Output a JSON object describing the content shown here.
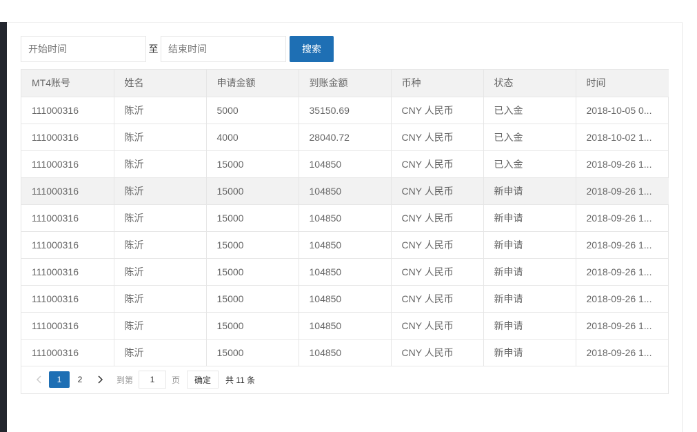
{
  "filter": {
    "start_placeholder": "开始时间",
    "separator": "至",
    "end_placeholder": "结束时间",
    "search_label": "搜索"
  },
  "table": {
    "headers": [
      "MT4账号",
      "姓名",
      "申请金额",
      "到账金额",
      "币种",
      "状态",
      "时间"
    ],
    "rows": [
      [
        "111000316",
        "陈沂",
        "5000",
        "35150.69",
        "CNY 人民币",
        "已入金",
        "2018-10-05 0..."
      ],
      [
        "111000316",
        "陈沂",
        "4000",
        "28040.72",
        "CNY 人民币",
        "已入金",
        "2018-10-02 1..."
      ],
      [
        "111000316",
        "陈沂",
        "15000",
        "104850",
        "CNY 人民币",
        "已入金",
        "2018-09-26 1..."
      ],
      [
        "111000316",
        "陈沂",
        "15000",
        "104850",
        "CNY 人民币",
        "新申请",
        "2018-09-26 1..."
      ],
      [
        "111000316",
        "陈沂",
        "15000",
        "104850",
        "CNY 人民币",
        "新申请",
        "2018-09-26 1..."
      ],
      [
        "111000316",
        "陈沂",
        "15000",
        "104850",
        "CNY 人民币",
        "新申请",
        "2018-09-26 1..."
      ],
      [
        "111000316",
        "陈沂",
        "15000",
        "104850",
        "CNY 人民币",
        "新申请",
        "2018-09-26 1..."
      ],
      [
        "111000316",
        "陈沂",
        "15000",
        "104850",
        "CNY 人民币",
        "新申请",
        "2018-09-26 1..."
      ],
      [
        "111000316",
        "陈沂",
        "15000",
        "104850",
        "CNY 人民币",
        "新申请",
        "2018-09-26 1..."
      ],
      [
        "111000316",
        "陈沂",
        "15000",
        "104850",
        "CNY 人民币",
        "新申请",
        "2018-09-26 1..."
      ]
    ]
  },
  "pager": {
    "pages": [
      "1",
      "2"
    ],
    "current_page": "1",
    "goto_label": "到第",
    "goto_value": "1",
    "page_unit": "页",
    "confirm_label": "确定",
    "total_label": "共 11 条"
  },
  "colors": {
    "primary": "#1e6fb4",
    "header_bg": "#f2f2f2",
    "border": "#e6e6e6"
  }
}
